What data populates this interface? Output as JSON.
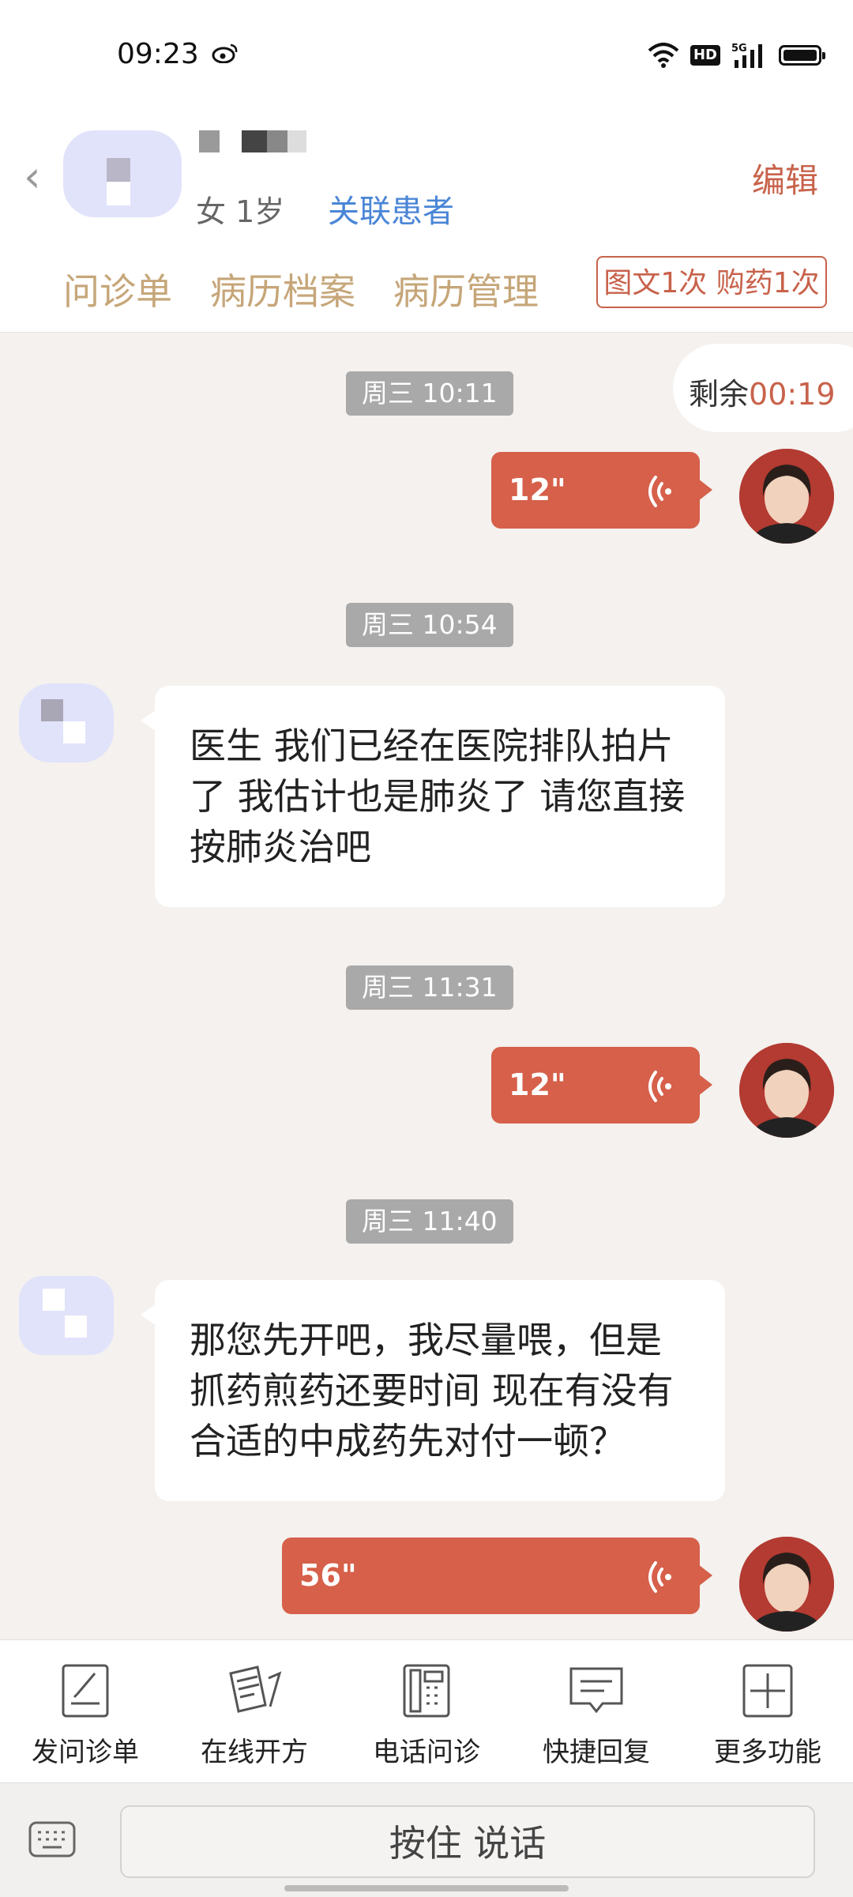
{
  "status": {
    "time": "09:23",
    "hd": "HD",
    "network": "5G"
  },
  "header": {
    "patient_info": "女 1岁",
    "link_patient": "关联患者",
    "edit": "编辑",
    "tabs": [
      "问诊单",
      "病历档案",
      "病历管理"
    ],
    "usage": "图文1次 购药1次"
  },
  "timer": {
    "label": "剩余",
    "time": "00:19"
  },
  "chat": {
    "ts1": "周三 10:11",
    "voice1": "12\"",
    "ts2": "周三 10:54",
    "msg1": "医生 我们已经在医院排队拍片了 我估计也是肺炎了 请您直接按肺炎治吧",
    "ts3": "周三 11:31",
    "voice2": "12\"",
    "ts4": "周三 11:40",
    "msg2": "那您先开吧，我尽量喂，但是抓药煎药还要时间 现在有没有合适的中成药先对付一顿？",
    "voice3": "56\""
  },
  "toolbar": {
    "items": [
      "发问诊单",
      "在线开方",
      "电话问诊",
      "快捷回复",
      "更多功能"
    ]
  },
  "input": {
    "talk": "按住 说话"
  },
  "colors": {
    "accent": "#d6604a",
    "tab": "#c6a679",
    "link": "#4a86d6"
  }
}
